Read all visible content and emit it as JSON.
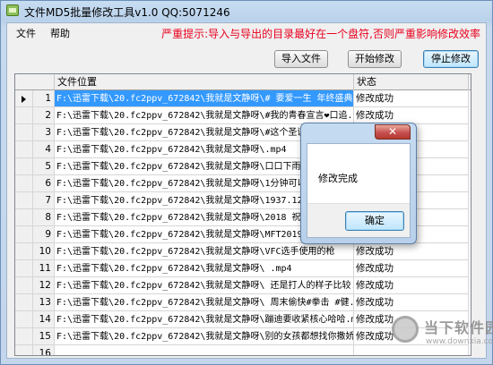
{
  "window": {
    "title": "文件MD5批量修改工具v1.0   QQ:5071246"
  },
  "menu": [
    {
      "label": "文件"
    },
    {
      "label": "帮助"
    }
  ],
  "warning": "严重提示:导入与导出的目录最好在一个盘符,否则严重影响修改效率",
  "toolbar": {
    "import_label": "导入文件",
    "start_label": "开始修改",
    "stop_label": "停止修改"
  },
  "grid": {
    "columns": [
      "文件位置",
      "状态"
    ],
    "rows": [
      {
        "num": "1",
        "path": "F:\\迅雷下载\\20.fc2ppv_672842\\我就是文静呀\\# 要爱一生 年终盛典 ...",
        "status": "修改成功"
      },
      {
        "num": "2",
        "path": "F:\\迅雷下载\\20.fc2ppv_672842\\我就是文静呀\\#我的青春宣言❤口追...",
        "status": "修改成功"
      },
      {
        "num": "3",
        "path": "F:\\迅雷下载\\20.fc2ppv_672842\\我就是文静呀\\#这个圣诞好嗨哟",
        "status": "修改成功"
      },
      {
        "num": "4",
        "path": "F:\\迅雷下载\\20.fc2ppv_672842\\我就是文静呀\\.mp4",
        "status": "修改成功"
      },
      {
        "num": "5",
        "path": "F:\\迅雷下载\\20.fc2ppv_672842\\我就是文静呀\\口口下雨天要开",
        "status": "修改成功"
      },
      {
        "num": "6",
        "path": "F:\\迅雷下载\\20.fc2ppv_672842\\我就是文静呀\\1分钟可以练习们",
        "status": "修改成功"
      },
      {
        "num": "7",
        "path": "F:\\迅雷下载\\20.fc2ppv_672842\\我就是文静呀\\1937.12.13 这一",
        "status": "修改成功"
      },
      {
        "num": "8",
        "path": "F:\\迅雷下载\\20.fc2ppv_672842\\我就是文静呀\\2018    祝大家",
        "status": "修改成功"
      },
      {
        "num": "9",
        "path": "F:\\迅雷下载\\20.fc2ppv_672842\\我就是文静呀\\MFT2019年度广告",
        "status": "修改成功"
      },
      {
        "num": "10",
        "path": "F:\\迅雷下载\\20.fc2ppv_672842\\我就是文静呀\\VFC选手使用的枪",
        "status": "修改成功"
      },
      {
        "num": "11",
        "path": "F:\\迅雷下载\\20.fc2ppv_672842\\我就是文静呀\\ .mp4",
        "status": "修改成功"
      },
      {
        "num": "12",
        "path": "F:\\迅雷下载\\20.fc2ppv_672842\\我就是文静呀\\  还是打人的样子比较...",
        "status": "修改成功"
      },
      {
        "num": "13",
        "path": "F:\\迅雷下载\\20.fc2ppv_672842\\我就是文静呀\\  周末偷快#拳击 #健...",
        "status": "修改成功"
      },
      {
        "num": "14",
        "path": "F:\\迅雷下载\\20.fc2ppv_672842\\我就是文静呀\\蹦迪要收紧核心哈哈.mp4",
        "status": "修改成功"
      },
      {
        "num": "15",
        "path": "F:\\迅雷下载\\20.fc2ppv_672842\\我就是文静呀\\别的女孩都想找你撒娇...",
        "status": "修改成功"
      },
      {
        "num": "16",
        "path": "",
        "status": ""
      }
    ]
  },
  "dialog": {
    "close_glyph": "✕",
    "message": "修改完成",
    "ok_label": "确定"
  },
  "watermark": {
    "text": "当下软件园",
    "url": "www.downxia.com"
  }
}
